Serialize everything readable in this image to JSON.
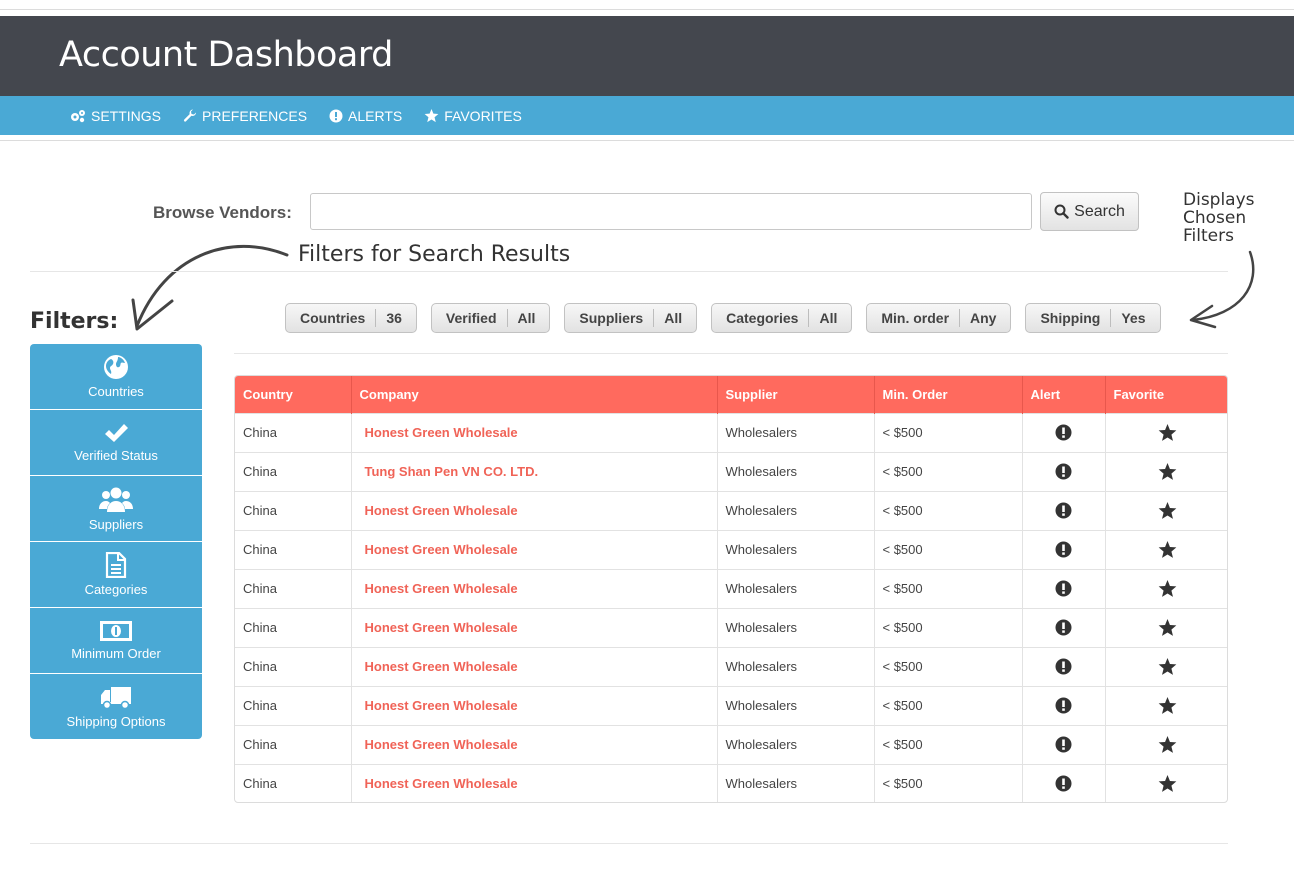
{
  "header": {
    "title": "Account Dashboard"
  },
  "nav": {
    "items": [
      {
        "label": "SETTINGS",
        "icon": "gears-icon"
      },
      {
        "label": "PREFERENCES",
        "icon": "wrench-icon"
      },
      {
        "label": "ALERTS",
        "icon": "exclamation-circle-icon"
      },
      {
        "label": "FAVORITES",
        "icon": "star-icon"
      }
    ]
  },
  "search": {
    "label": "Browse Vendors:",
    "value": "",
    "placeholder": "",
    "button_label": "Search",
    "button_icon": "search-icon"
  },
  "annotations": {
    "filters_results": "Filters for Search Results",
    "displays_line1": "Displays",
    "displays_line2": "Chosen",
    "displays_line3": "Filters"
  },
  "sidebar": {
    "title": "Filters:",
    "items": [
      {
        "label": "Countries",
        "icon": "globe-icon"
      },
      {
        "label": "Verified Status",
        "icon": "check-icon"
      },
      {
        "label": "Suppliers",
        "icon": "users-icon"
      },
      {
        "label": "Categories",
        "icon": "document-icon"
      },
      {
        "label": "Minimum Order",
        "icon": "money-icon"
      },
      {
        "label": "Shipping Options",
        "icon": "truck-icon"
      }
    ]
  },
  "chips": [
    {
      "key": "Countries",
      "value": "36"
    },
    {
      "key": "Verified",
      "value": "All"
    },
    {
      "key": "Suppliers",
      "value": "All"
    },
    {
      "key": "Categories",
      "value": "All"
    },
    {
      "key": "Min. order",
      "value": "Any"
    },
    {
      "key": "Shipping",
      "value": "Yes"
    }
  ],
  "table": {
    "headers": [
      "Country",
      "Company",
      "Supplier",
      "Min. Order",
      "Alert",
      "Favorite"
    ],
    "rows": [
      {
        "country": "China",
        "company": "Honest Green Wholesale",
        "supplier": "Wholesalers",
        "min_order": "< $500"
      },
      {
        "country": "China",
        "company": "Tung Shan Pen VN CO. LTD.",
        "supplier": "Wholesalers",
        "min_order": "< $500"
      },
      {
        "country": "China",
        "company": "Honest Green Wholesale",
        "supplier": "Wholesalers",
        "min_order": "< $500"
      },
      {
        "country": "China",
        "company": "Honest Green Wholesale",
        "supplier": "Wholesalers",
        "min_order": "< $500"
      },
      {
        "country": "China",
        "company": "Honest Green Wholesale",
        "supplier": "Wholesalers",
        "min_order": "< $500"
      },
      {
        "country": "China",
        "company": "Honest Green Wholesale",
        "supplier": "Wholesalers",
        "min_order": "< $500"
      },
      {
        "country": "China",
        "company": "Honest Green Wholesale",
        "supplier": "Wholesalers",
        "min_order": "< $500"
      },
      {
        "country": "China",
        "company": "Honest Green Wholesale",
        "supplier": "Wholesalers",
        "min_order": "< $500"
      },
      {
        "country": "China",
        "company": "Honest Green Wholesale",
        "supplier": "Wholesalers",
        "min_order": "< $500"
      },
      {
        "country": "China",
        "company": "Honest Green Wholesale",
        "supplier": "Wholesalers",
        "min_order": "< $500"
      }
    ]
  },
  "colors": {
    "header_bg": "#44474e",
    "nav_bg": "#4aa9d5",
    "table_header_bg": "#ff6a5e",
    "company_link": "#f06357"
  }
}
